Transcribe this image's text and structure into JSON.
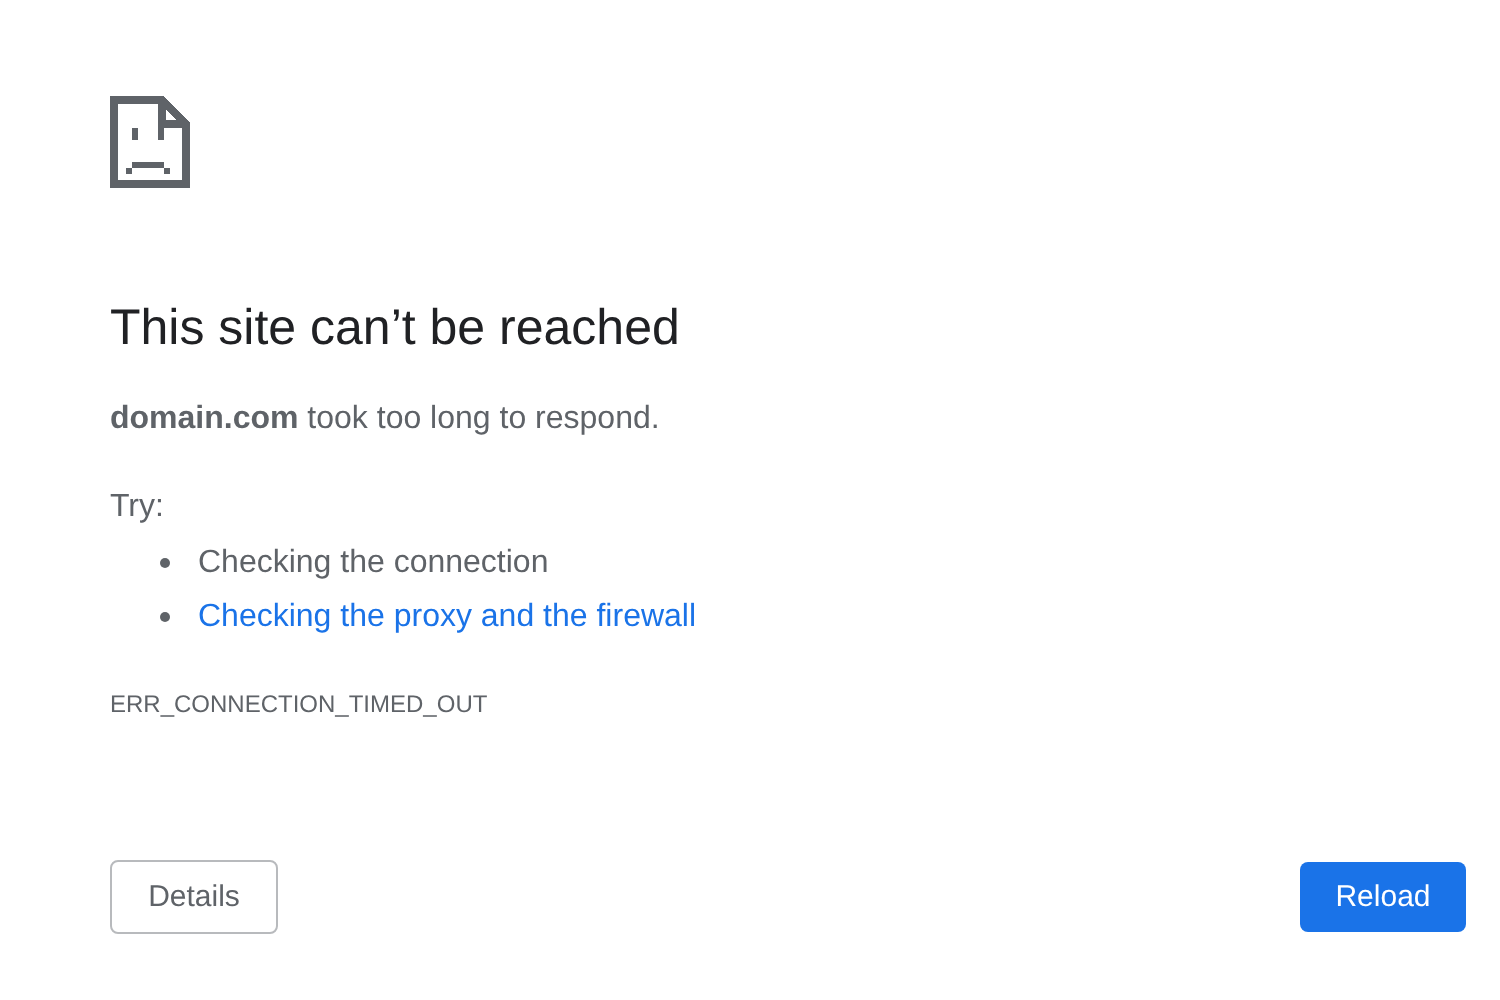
{
  "title": "This site can’t be reached",
  "description": "**domain.com** took too long to respond.",
  "suggestions_heading": "Try:",
  "suggestions": [
    {
      "kind": "text",
      "label": "Checking the connection"
    },
    {
      "kind": "link",
      "label": "Checking the proxy and the firewall"
    }
  ],
  "error_code": "ERR_CONNECTION_TIMED_OUT",
  "buttons": {
    "details": "Details",
    "reload": "Reload"
  }
}
